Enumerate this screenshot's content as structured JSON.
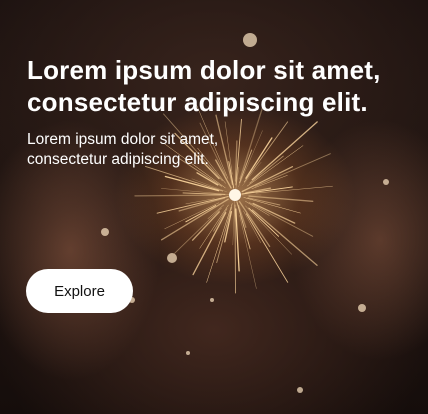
{
  "hero": {
    "title": "Lorem ipsum dolor sit amet, consectetur adipiscing elit.",
    "subtitle": "Lorem ipsum dolor sit amet, consectetur adipiscing elit.",
    "cta_label": "Explore"
  },
  "colors": {
    "text": "#ffffff",
    "button_bg": "#ffffff",
    "button_text": "#111111",
    "spark": "#ffd9a0"
  }
}
